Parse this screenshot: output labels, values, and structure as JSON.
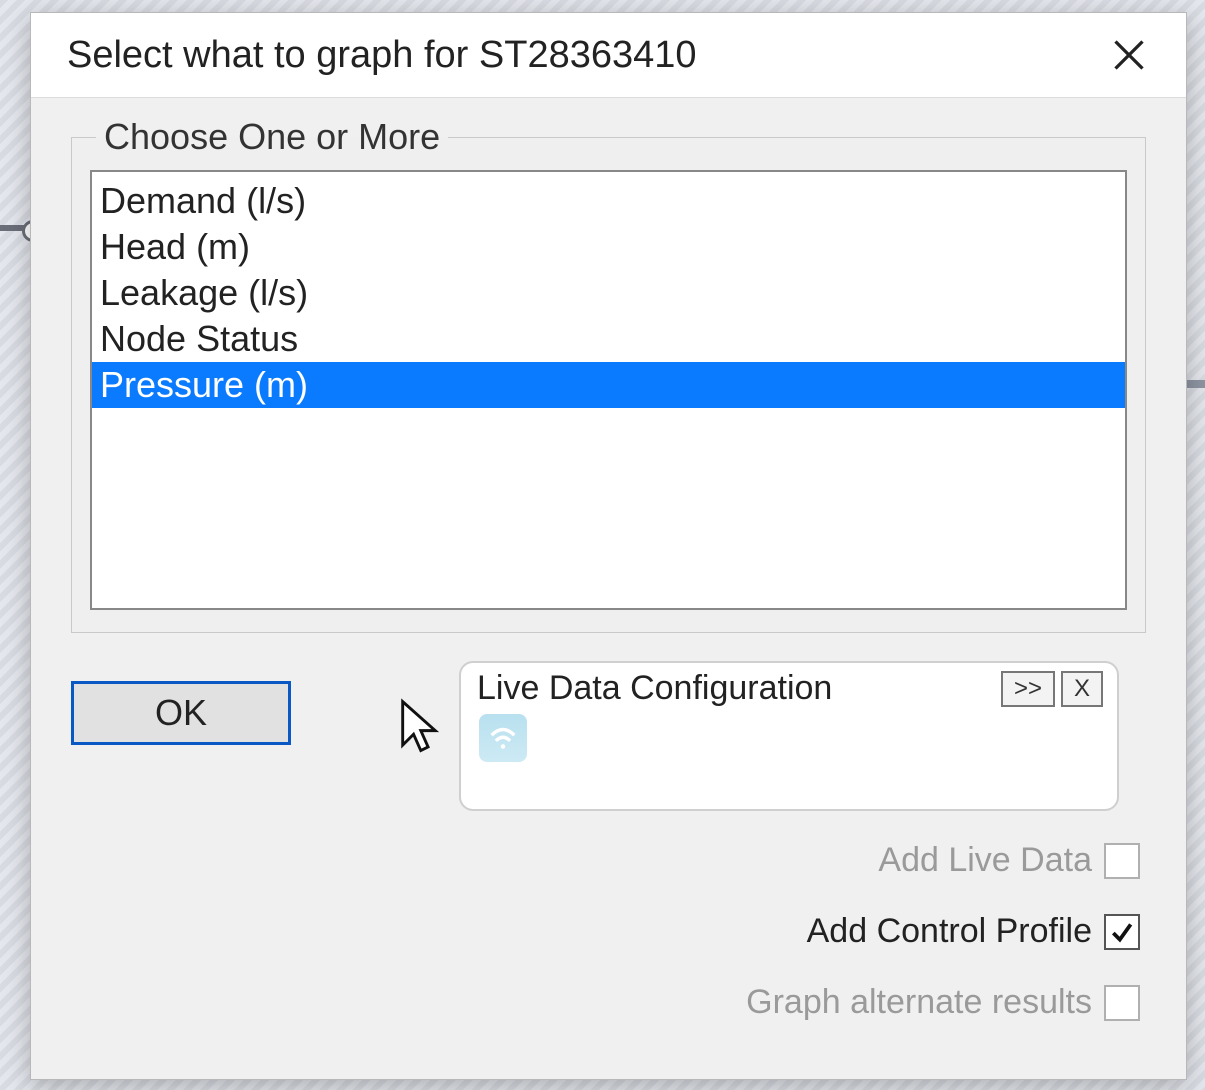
{
  "dialog": {
    "title": "Select what to graph for ST28363410"
  },
  "group": {
    "legend": "Choose One or More"
  },
  "list": {
    "items": [
      {
        "label": "Demand (l/s)",
        "selected": false
      },
      {
        "label": "Head (m)",
        "selected": false
      },
      {
        "label": "Leakage (l/s)",
        "selected": false
      },
      {
        "label": "Node Status",
        "selected": false
      },
      {
        "label": "Pressure (m)",
        "selected": true
      }
    ]
  },
  "buttons": {
    "ok": "OK"
  },
  "live": {
    "title": "Live Data Configuration",
    "expand": ">>",
    "close": "X"
  },
  "checks": {
    "add_live_data": {
      "label": "Add Live Data",
      "checked": false,
      "enabled": false
    },
    "add_control_profile": {
      "label": "Add Control Profile",
      "checked": true,
      "enabled": true
    },
    "graph_alternate_results": {
      "label": "Graph alternate results",
      "checked": false,
      "enabled": false
    }
  }
}
